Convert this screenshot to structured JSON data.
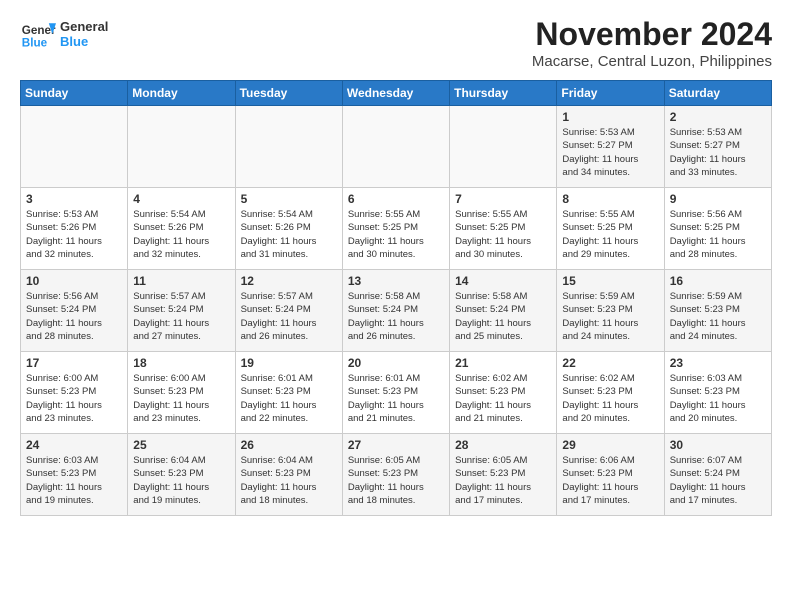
{
  "header": {
    "logo_line1": "General",
    "logo_line2": "Blue",
    "month": "November 2024",
    "location": "Macarse, Central Luzon, Philippines"
  },
  "weekdays": [
    "Sunday",
    "Monday",
    "Tuesday",
    "Wednesday",
    "Thursday",
    "Friday",
    "Saturday"
  ],
  "weeks": [
    [
      {
        "day": "",
        "info": ""
      },
      {
        "day": "",
        "info": ""
      },
      {
        "day": "",
        "info": ""
      },
      {
        "day": "",
        "info": ""
      },
      {
        "day": "",
        "info": ""
      },
      {
        "day": "1",
        "info": "Sunrise: 5:53 AM\nSunset: 5:27 PM\nDaylight: 11 hours\nand 34 minutes."
      },
      {
        "day": "2",
        "info": "Sunrise: 5:53 AM\nSunset: 5:27 PM\nDaylight: 11 hours\nand 33 minutes."
      }
    ],
    [
      {
        "day": "3",
        "info": "Sunrise: 5:53 AM\nSunset: 5:26 PM\nDaylight: 11 hours\nand 32 minutes."
      },
      {
        "day": "4",
        "info": "Sunrise: 5:54 AM\nSunset: 5:26 PM\nDaylight: 11 hours\nand 32 minutes."
      },
      {
        "day": "5",
        "info": "Sunrise: 5:54 AM\nSunset: 5:26 PM\nDaylight: 11 hours\nand 31 minutes."
      },
      {
        "day": "6",
        "info": "Sunrise: 5:55 AM\nSunset: 5:25 PM\nDaylight: 11 hours\nand 30 minutes."
      },
      {
        "day": "7",
        "info": "Sunrise: 5:55 AM\nSunset: 5:25 PM\nDaylight: 11 hours\nand 30 minutes."
      },
      {
        "day": "8",
        "info": "Sunrise: 5:55 AM\nSunset: 5:25 PM\nDaylight: 11 hours\nand 29 minutes."
      },
      {
        "day": "9",
        "info": "Sunrise: 5:56 AM\nSunset: 5:25 PM\nDaylight: 11 hours\nand 28 minutes."
      }
    ],
    [
      {
        "day": "10",
        "info": "Sunrise: 5:56 AM\nSunset: 5:24 PM\nDaylight: 11 hours\nand 28 minutes."
      },
      {
        "day": "11",
        "info": "Sunrise: 5:57 AM\nSunset: 5:24 PM\nDaylight: 11 hours\nand 27 minutes."
      },
      {
        "day": "12",
        "info": "Sunrise: 5:57 AM\nSunset: 5:24 PM\nDaylight: 11 hours\nand 26 minutes."
      },
      {
        "day": "13",
        "info": "Sunrise: 5:58 AM\nSunset: 5:24 PM\nDaylight: 11 hours\nand 26 minutes."
      },
      {
        "day": "14",
        "info": "Sunrise: 5:58 AM\nSunset: 5:24 PM\nDaylight: 11 hours\nand 25 minutes."
      },
      {
        "day": "15",
        "info": "Sunrise: 5:59 AM\nSunset: 5:23 PM\nDaylight: 11 hours\nand 24 minutes."
      },
      {
        "day": "16",
        "info": "Sunrise: 5:59 AM\nSunset: 5:23 PM\nDaylight: 11 hours\nand 24 minutes."
      }
    ],
    [
      {
        "day": "17",
        "info": "Sunrise: 6:00 AM\nSunset: 5:23 PM\nDaylight: 11 hours\nand 23 minutes."
      },
      {
        "day": "18",
        "info": "Sunrise: 6:00 AM\nSunset: 5:23 PM\nDaylight: 11 hours\nand 23 minutes."
      },
      {
        "day": "19",
        "info": "Sunrise: 6:01 AM\nSunset: 5:23 PM\nDaylight: 11 hours\nand 22 minutes."
      },
      {
        "day": "20",
        "info": "Sunrise: 6:01 AM\nSunset: 5:23 PM\nDaylight: 11 hours\nand 21 minutes."
      },
      {
        "day": "21",
        "info": "Sunrise: 6:02 AM\nSunset: 5:23 PM\nDaylight: 11 hours\nand 21 minutes."
      },
      {
        "day": "22",
        "info": "Sunrise: 6:02 AM\nSunset: 5:23 PM\nDaylight: 11 hours\nand 20 minutes."
      },
      {
        "day": "23",
        "info": "Sunrise: 6:03 AM\nSunset: 5:23 PM\nDaylight: 11 hours\nand 20 minutes."
      }
    ],
    [
      {
        "day": "24",
        "info": "Sunrise: 6:03 AM\nSunset: 5:23 PM\nDaylight: 11 hours\nand 19 minutes."
      },
      {
        "day": "25",
        "info": "Sunrise: 6:04 AM\nSunset: 5:23 PM\nDaylight: 11 hours\nand 19 minutes."
      },
      {
        "day": "26",
        "info": "Sunrise: 6:04 AM\nSunset: 5:23 PM\nDaylight: 11 hours\nand 18 minutes."
      },
      {
        "day": "27",
        "info": "Sunrise: 6:05 AM\nSunset: 5:23 PM\nDaylight: 11 hours\nand 18 minutes."
      },
      {
        "day": "28",
        "info": "Sunrise: 6:05 AM\nSunset: 5:23 PM\nDaylight: 11 hours\nand 17 minutes."
      },
      {
        "day": "29",
        "info": "Sunrise: 6:06 AM\nSunset: 5:23 PM\nDaylight: 11 hours\nand 17 minutes."
      },
      {
        "day": "30",
        "info": "Sunrise: 6:07 AM\nSunset: 5:24 PM\nDaylight: 11 hours\nand 17 minutes."
      }
    ]
  ]
}
